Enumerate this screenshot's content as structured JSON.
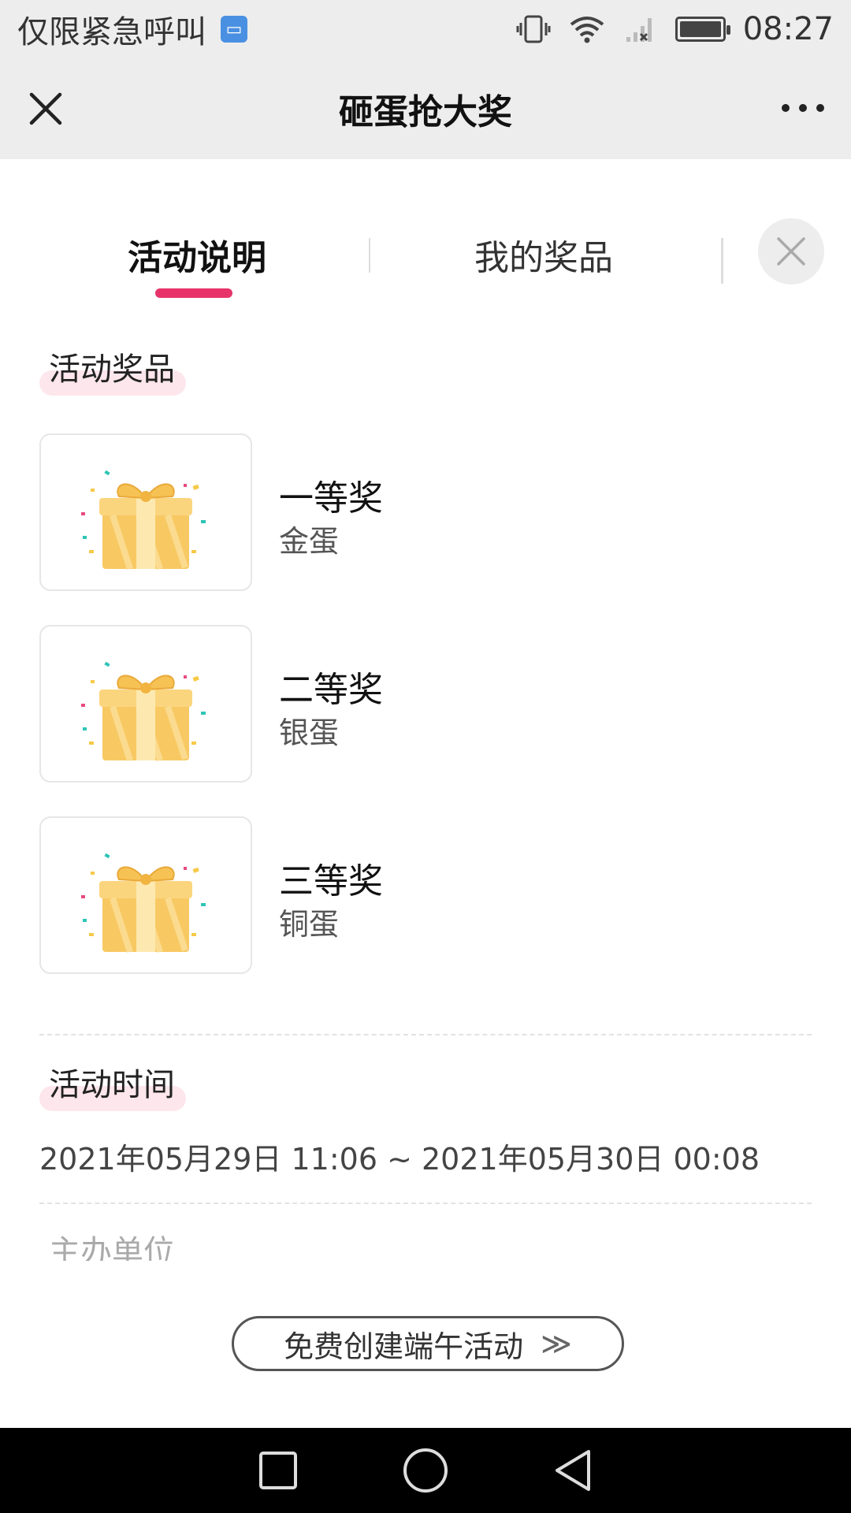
{
  "status_bar": {
    "left_text": "仅限紧急呼叫",
    "sim_label": "▭",
    "time": "08:27",
    "icons": [
      "vibrate-icon",
      "wifi-icon",
      "signal-icon",
      "battery-icon"
    ]
  },
  "header": {
    "title": "砸蛋抢大奖"
  },
  "tabs": [
    {
      "label": "活动说明",
      "active": true
    },
    {
      "label": "我的奖品",
      "active": false
    }
  ],
  "sections": {
    "prizes_title": "活动奖品",
    "time_title": "活动时间",
    "organizer_title": "主办单位"
  },
  "prizes": [
    {
      "rank": "一等奖",
      "name": "金蛋",
      "icon": "gift-box-icon"
    },
    {
      "rank": "二等奖",
      "name": "银蛋",
      "icon": "gift-box-icon"
    },
    {
      "rank": "三等奖",
      "name": "铜蛋",
      "icon": "gift-box-icon"
    }
  ],
  "activity_time": "2021年05月29日 11:06 ~ 2021年05月30日 00:08",
  "cta": {
    "label": "免费创建端午活动",
    "arrow": "≫"
  },
  "colors": {
    "accent": "#e8336a",
    "highlight": "#fde6ec",
    "bar_bg": "#ededed"
  }
}
